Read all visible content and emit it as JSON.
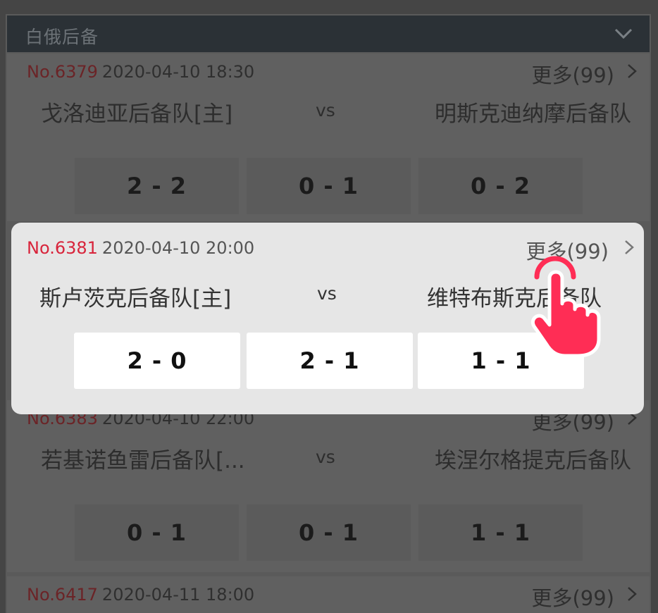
{
  "league": {
    "name": "白俄后备"
  },
  "icons": {
    "collapse": "chevron-down-icon",
    "more": "chevron-right-icon",
    "pointer": "hand-pointer-icon"
  },
  "colors": {
    "match_no": "#d8243b",
    "pointer": "#ff2d55"
  },
  "matches": [
    {
      "no": "No.6379",
      "time": "2020-04-10 18:30",
      "more": "更多(99)",
      "home": "戈洛迪亚后备队[主]",
      "vs": "vs",
      "away": "明斯克迪纳摩后备队",
      "odds": [
        "2 - 2",
        "0 - 1",
        "0 - 2"
      ]
    },
    {
      "no": "No.6381",
      "time": "2020-04-10 20:00",
      "more": "更多(99)",
      "home": "斯卢茨克后备队[主]",
      "vs": "vs",
      "away": "维特布斯克后备队",
      "odds": [
        "2 - 0",
        "2 - 1",
        "1 - 1"
      ]
    },
    {
      "no": "No.6383",
      "time": "2020-04-10 22:00",
      "more": "更多(99)",
      "home": "若基诺鱼雷后备队[...",
      "vs": "vs",
      "away": "埃涅尔格提克后备队",
      "odds": [
        "0 - 1",
        "0 - 1",
        "1 - 1"
      ]
    },
    {
      "no": "No.6417",
      "time": "2020-04-11 18:00",
      "more": "更多(99)"
    }
  ]
}
